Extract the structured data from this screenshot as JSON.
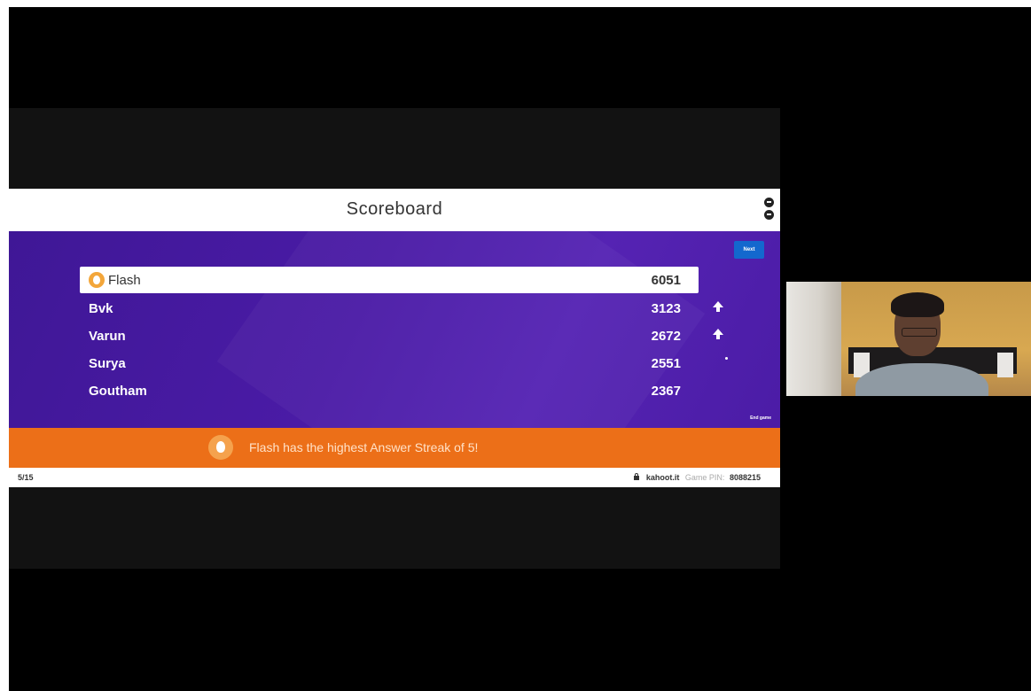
{
  "scoreboard": {
    "title": "Scoreboard",
    "next_label": "Next",
    "end_link": "End game",
    "rows": [
      {
        "name": "Flash",
        "score": "6051",
        "trend": "none"
      },
      {
        "name": "Bvk",
        "score": "3123",
        "trend": "up"
      },
      {
        "name": "Varun",
        "score": "2672",
        "trend": "up"
      },
      {
        "name": "Surya",
        "score": "2551",
        "trend": "none"
      },
      {
        "name": "Goutham",
        "score": "2367",
        "trend": "none"
      }
    ]
  },
  "streak_banner": {
    "text": "Flash has the highest Answer Streak of 5!"
  },
  "footer": {
    "progress": "5/15",
    "site": "kahoot.it",
    "pin_label": "Game PIN:",
    "pin_value": "8088215"
  },
  "colors": {
    "board": "#4a1ba6",
    "banner": "#ec6f18",
    "next_button": "#1368ce"
  },
  "icons": {
    "top_player": "flame-icon",
    "trend_up": "arrow-up-icon",
    "lock": "lock-icon"
  }
}
